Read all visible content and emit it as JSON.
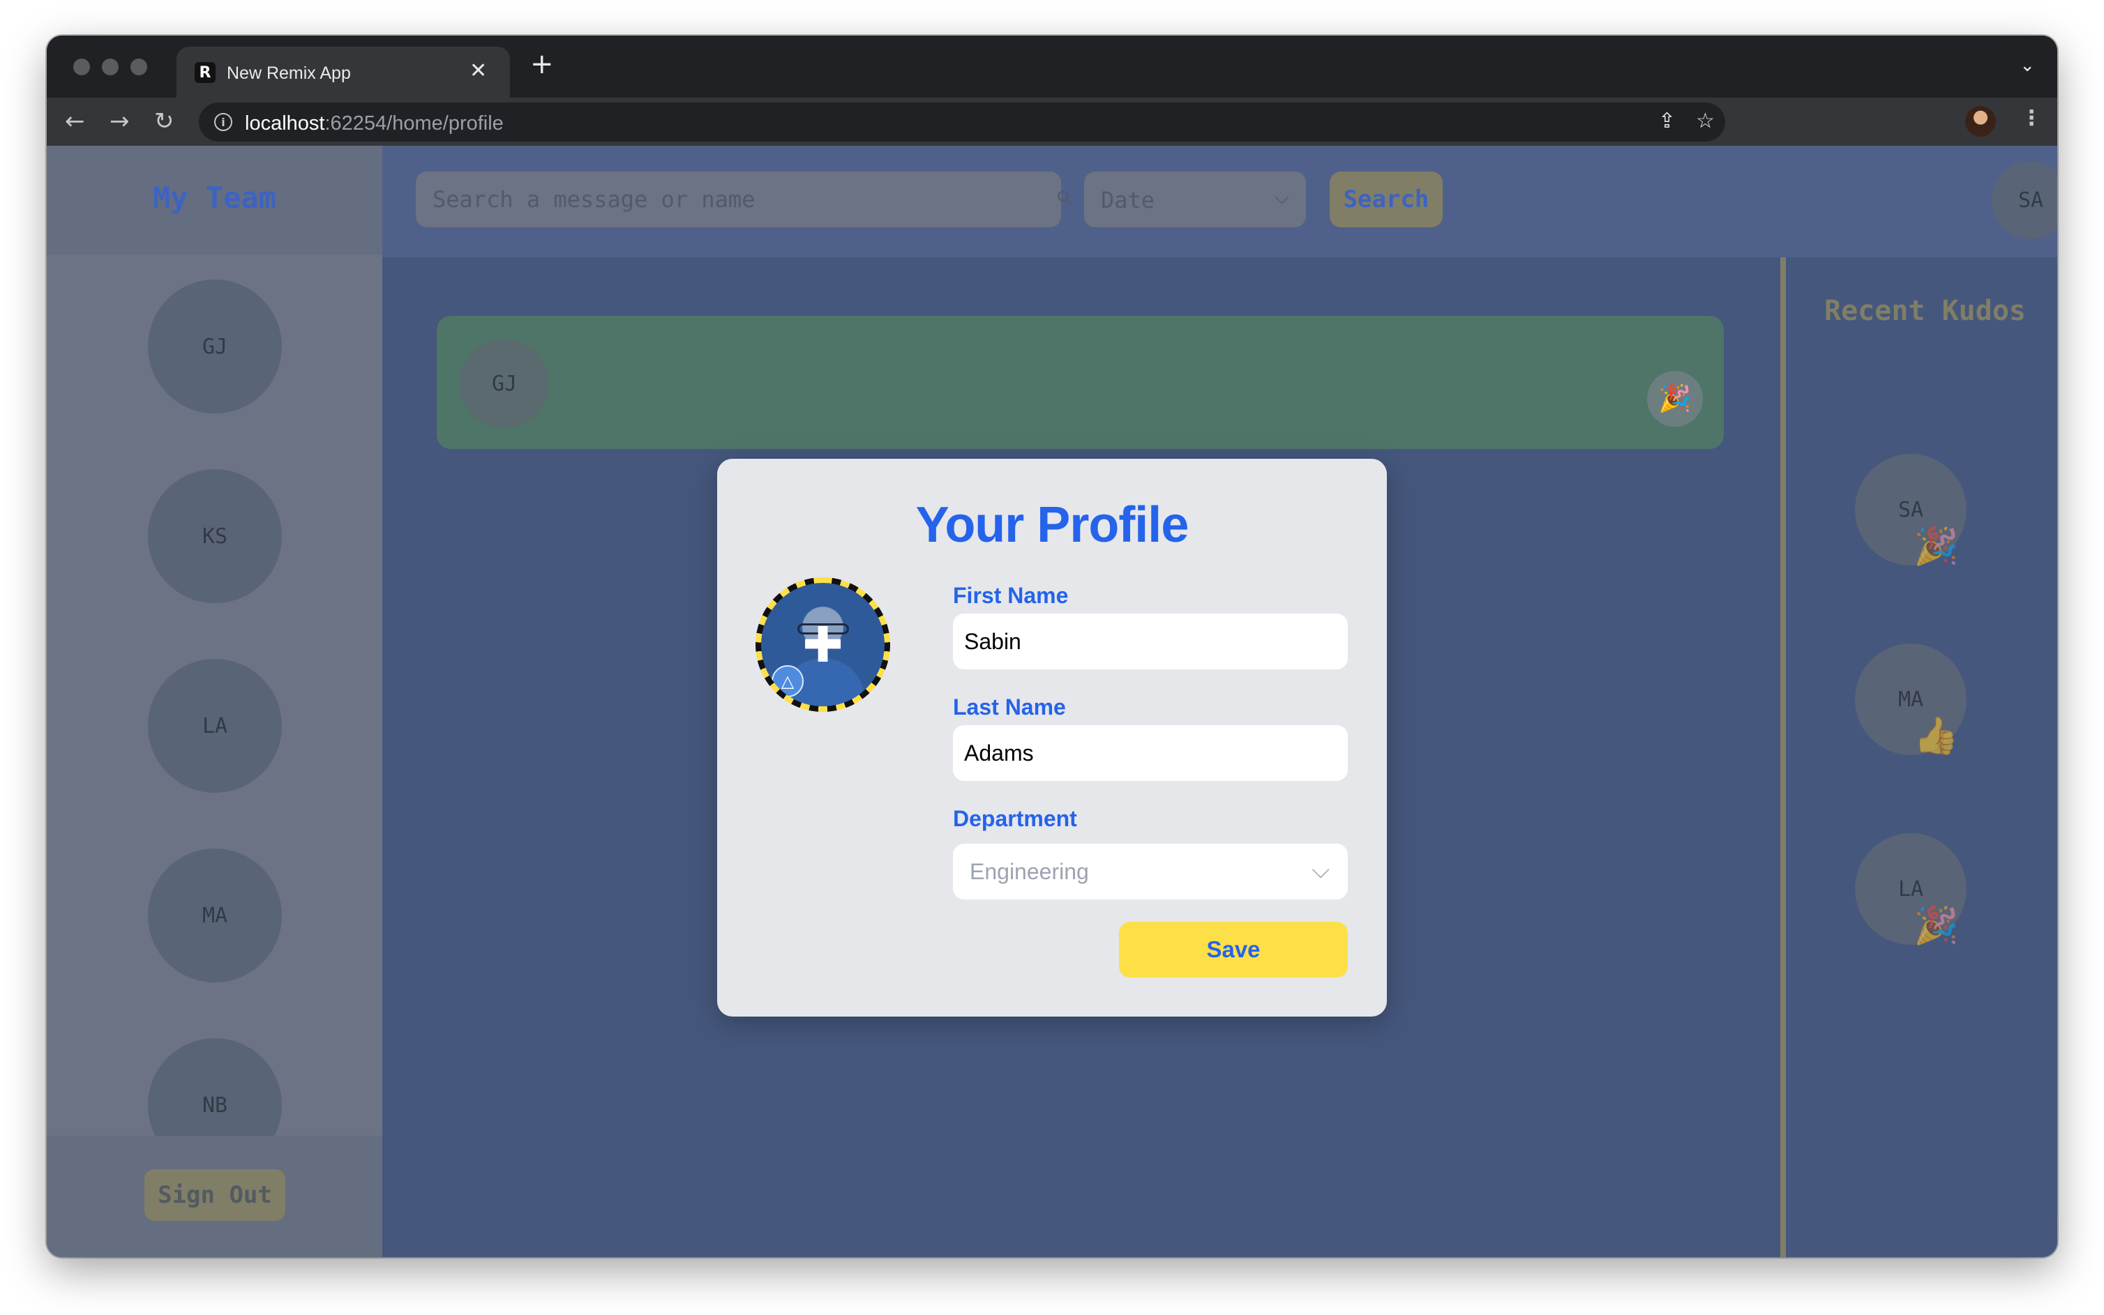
{
  "browser": {
    "tab_title": "New Remix App",
    "tab_favicon": "R",
    "tab_close_icon": "✕",
    "new_tab_icon": "+",
    "tab_menu_icon": "⌄",
    "url_host": "localhost",
    "url_rest": ":62254/home/profile",
    "back_icon": "←",
    "forward_icon": "→",
    "reload_icon": "↻",
    "info_icon": "i",
    "share_icon": "⇪",
    "bookmark_icon": "☆",
    "menu_icon": "⋮"
  },
  "sidebar": {
    "title": "My Team",
    "members": [
      "GJ",
      "KS",
      "LA",
      "MA",
      "NB"
    ],
    "sign_out_label": "Sign Out"
  },
  "topbar": {
    "search_placeholder": "Search a message or name",
    "search_icon": "⚲",
    "date_label": "Date",
    "search_button": "Search",
    "user_initials": "SA"
  },
  "feed": {
    "card_initials": "GJ",
    "card_emoji": "🎉"
  },
  "recent_kudos": {
    "title": "Recent Kudos",
    "items": [
      {
        "initials": "SA",
        "emoji": "🎉"
      },
      {
        "initials": "MA",
        "emoji": "👍"
      },
      {
        "initials": "LA",
        "emoji": "🎉"
      }
    ]
  },
  "profile_modal": {
    "title": "Your Profile",
    "photo_plus_icon": "✚",
    "photo_badge_icon": "△",
    "first_name_label": "First Name",
    "first_name_value": "Sabin",
    "last_name_label": "Last Name",
    "last_name_value": "Adams",
    "department_label": "Department",
    "department_value": "Engineering",
    "dropdown_icon": "⌵",
    "save_label": "Save"
  },
  "colors": {
    "accent_blue": "#2563eb",
    "accent_yellow": "#fde047",
    "page_background": "#45577d"
  }
}
